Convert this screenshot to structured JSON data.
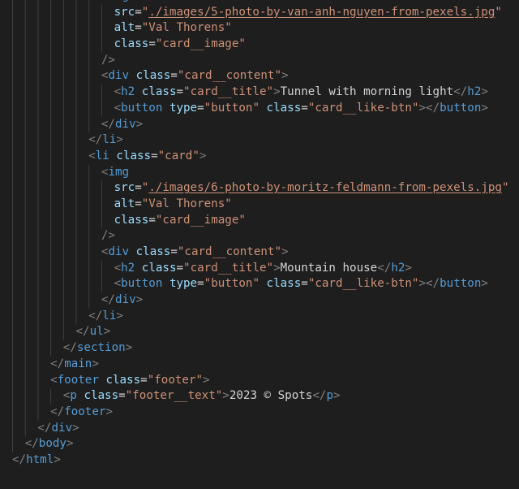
{
  "editor": {
    "language": "html",
    "colors": {
      "background": "#1e1e1e",
      "tag": "#569cd6",
      "bracket": "#808080",
      "attribute": "#9cdcfe",
      "string": "#ce9178",
      "text": "#d4d4d4",
      "indent_guide": "#404040"
    },
    "lines": [
      {
        "indent": 7,
        "tokens": [
          [
            "b",
            "<"
          ],
          [
            "t",
            "img"
          ]
        ]
      },
      {
        "indent": 8,
        "tokens": [
          [
            "a",
            "src"
          ],
          [
            "p",
            "="
          ],
          [
            "v",
            "\""
          ],
          [
            "link",
            "./images/5-photo-by-van-anh-nguyen-from-pexels.jpg"
          ],
          [
            "v",
            "\""
          ]
        ]
      },
      {
        "indent": 8,
        "tokens": [
          [
            "a",
            "alt"
          ],
          [
            "p",
            "="
          ],
          [
            "v",
            "\"Val Thorens\""
          ]
        ]
      },
      {
        "indent": 8,
        "tokens": [
          [
            "a",
            "class"
          ],
          [
            "p",
            "="
          ],
          [
            "v",
            "\"card__image\""
          ]
        ]
      },
      {
        "indent": 7,
        "tokens": [
          [
            "b",
            "/>"
          ]
        ]
      },
      {
        "indent": 7,
        "tokens": [
          [
            "b",
            "<"
          ],
          [
            "t",
            "div"
          ],
          [
            "p",
            " "
          ],
          [
            "a",
            "class"
          ],
          [
            "p",
            "="
          ],
          [
            "v",
            "\"card__content\""
          ],
          [
            "b",
            ">"
          ]
        ]
      },
      {
        "indent": 8,
        "tokens": [
          [
            "b",
            "<"
          ],
          [
            "t",
            "h2"
          ],
          [
            "p",
            " "
          ],
          [
            "a",
            "class"
          ],
          [
            "p",
            "="
          ],
          [
            "v",
            "\"card__title\""
          ],
          [
            "b",
            ">"
          ],
          [
            "p",
            "Tunnel with morning light"
          ],
          [
            "b",
            "</"
          ],
          [
            "t",
            "h2"
          ],
          [
            "b",
            ">"
          ]
        ]
      },
      {
        "indent": 8,
        "tokens": [
          [
            "b",
            "<"
          ],
          [
            "t",
            "button"
          ],
          [
            "p",
            " "
          ],
          [
            "a",
            "type"
          ],
          [
            "p",
            "="
          ],
          [
            "v",
            "\"button\""
          ],
          [
            "p",
            " "
          ],
          [
            "a",
            "class"
          ],
          [
            "p",
            "="
          ],
          [
            "v",
            "\"card__like-btn\""
          ],
          [
            "b",
            "></"
          ],
          [
            "t",
            "button"
          ],
          [
            "b",
            ">"
          ]
        ]
      },
      {
        "indent": 7,
        "tokens": [
          [
            "b",
            "</"
          ],
          [
            "t",
            "div"
          ],
          [
            "b",
            ">"
          ]
        ]
      },
      {
        "indent": 6,
        "tokens": [
          [
            "b",
            "</"
          ],
          [
            "t",
            "li"
          ],
          [
            "b",
            ">"
          ]
        ]
      },
      {
        "indent": 6,
        "tokens": [
          [
            "b",
            "<"
          ],
          [
            "t",
            "li"
          ],
          [
            "p",
            " "
          ],
          [
            "a",
            "class"
          ],
          [
            "p",
            "="
          ],
          [
            "v",
            "\"card\""
          ],
          [
            "b",
            ">"
          ]
        ]
      },
      {
        "indent": 7,
        "tokens": [
          [
            "b",
            "<"
          ],
          [
            "t",
            "img"
          ]
        ]
      },
      {
        "indent": 8,
        "tokens": [
          [
            "a",
            "src"
          ],
          [
            "p",
            "="
          ],
          [
            "v",
            "\""
          ],
          [
            "link",
            "./images/6-photo-by-moritz-feldmann-from-pexels.jpg"
          ],
          [
            "v",
            "\""
          ]
        ]
      },
      {
        "indent": 8,
        "tokens": [
          [
            "a",
            "alt"
          ],
          [
            "p",
            "="
          ],
          [
            "v",
            "\"Val Thorens\""
          ]
        ]
      },
      {
        "indent": 8,
        "tokens": [
          [
            "a",
            "class"
          ],
          [
            "p",
            "="
          ],
          [
            "v",
            "\"card__image\""
          ]
        ]
      },
      {
        "indent": 7,
        "tokens": [
          [
            "b",
            "/>"
          ]
        ]
      },
      {
        "indent": 7,
        "tokens": [
          [
            "b",
            "<"
          ],
          [
            "t",
            "div"
          ],
          [
            "p",
            " "
          ],
          [
            "a",
            "class"
          ],
          [
            "p",
            "="
          ],
          [
            "v",
            "\"card__content\""
          ],
          [
            "b",
            ">"
          ]
        ]
      },
      {
        "indent": 8,
        "tokens": [
          [
            "b",
            "<"
          ],
          [
            "t",
            "h2"
          ],
          [
            "p",
            " "
          ],
          [
            "a",
            "class"
          ],
          [
            "p",
            "="
          ],
          [
            "v",
            "\"card__title\""
          ],
          [
            "b",
            ">"
          ],
          [
            "p",
            "Mountain house"
          ],
          [
            "b",
            "</"
          ],
          [
            "t",
            "h2"
          ],
          [
            "b",
            ">"
          ]
        ]
      },
      {
        "indent": 8,
        "tokens": [
          [
            "b",
            "<"
          ],
          [
            "t",
            "button"
          ],
          [
            "p",
            " "
          ],
          [
            "a",
            "type"
          ],
          [
            "p",
            "="
          ],
          [
            "v",
            "\"button\""
          ],
          [
            "p",
            " "
          ],
          [
            "a",
            "class"
          ],
          [
            "p",
            "="
          ],
          [
            "v",
            "\"card__like-btn\""
          ],
          [
            "b",
            "></"
          ],
          [
            "t",
            "button"
          ],
          [
            "b",
            ">"
          ]
        ]
      },
      {
        "indent": 7,
        "tokens": [
          [
            "b",
            "</"
          ],
          [
            "t",
            "div"
          ],
          [
            "b",
            ">"
          ]
        ]
      },
      {
        "indent": 6,
        "tokens": [
          [
            "b",
            "</"
          ],
          [
            "t",
            "li"
          ],
          [
            "b",
            ">"
          ]
        ]
      },
      {
        "indent": 5,
        "tokens": [
          [
            "b",
            "</"
          ],
          [
            "t",
            "ul"
          ],
          [
            "b",
            ">"
          ]
        ]
      },
      {
        "indent": 4,
        "tokens": [
          [
            "b",
            "</"
          ],
          [
            "t",
            "section"
          ],
          [
            "b",
            ">"
          ]
        ]
      },
      {
        "indent": 3,
        "tokens": [
          [
            "b",
            "</"
          ],
          [
            "t",
            "main"
          ],
          [
            "b",
            ">"
          ]
        ]
      },
      {
        "indent": 3,
        "tokens": [
          [
            "b",
            "<"
          ],
          [
            "t",
            "footer"
          ],
          [
            "p",
            " "
          ],
          [
            "a",
            "class"
          ],
          [
            "p",
            "="
          ],
          [
            "v",
            "\"footer\""
          ],
          [
            "b",
            ">"
          ]
        ]
      },
      {
        "indent": 4,
        "tokens": [
          [
            "b",
            "<"
          ],
          [
            "t",
            "p"
          ],
          [
            "p",
            " "
          ],
          [
            "a",
            "class"
          ],
          [
            "p",
            "="
          ],
          [
            "v",
            "\"footer__text\""
          ],
          [
            "b",
            ">"
          ],
          [
            "p",
            "2023 © Spots"
          ],
          [
            "b",
            "</"
          ],
          [
            "t",
            "p"
          ],
          [
            "b",
            ">"
          ]
        ]
      },
      {
        "indent": 3,
        "tokens": [
          [
            "b",
            "</"
          ],
          [
            "t",
            "footer"
          ],
          [
            "b",
            ">"
          ]
        ]
      },
      {
        "indent": 2,
        "tokens": [
          [
            "b",
            "</"
          ],
          [
            "t",
            "div"
          ],
          [
            "b",
            ">"
          ]
        ]
      },
      {
        "indent": 1,
        "tokens": [
          [
            "b",
            "</"
          ],
          [
            "t",
            "body"
          ],
          [
            "b",
            ">"
          ]
        ]
      },
      {
        "indent": 0,
        "tokens": [
          [
            "b",
            "</"
          ],
          [
            "t",
            "html"
          ],
          [
            "b",
            ">"
          ]
        ]
      }
    ]
  }
}
